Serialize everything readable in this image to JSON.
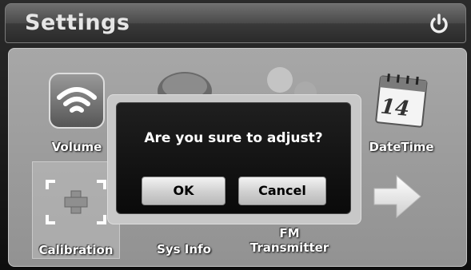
{
  "header": {
    "title": "Settings",
    "power_icon": "power-icon"
  },
  "tiles": [
    {
      "label": "Volume",
      "icon": "wifi-volume-icon"
    },
    {
      "label": "",
      "icon": "bubble-icon"
    },
    {
      "label": "",
      "icon": "users-icon"
    },
    {
      "label": "DateTime",
      "icon": "calendar-icon",
      "calendar_day": "14"
    },
    {
      "label": "Calibration",
      "icon": "crosshair-icon",
      "selected": true
    },
    {
      "label": "Sys Info",
      "icon": "info-icon"
    },
    {
      "label": "FM\nTransmitter",
      "label_line1": "FM",
      "label_line2": "Transmitter",
      "icon": "radio-icon"
    },
    {
      "label": "",
      "icon": "arrow-right-icon"
    }
  ],
  "dialog": {
    "message": "Are you sure to adjust?",
    "ok_label": "OK",
    "cancel_label": "Cancel"
  },
  "colors": {
    "panel": "#9e9e9e",
    "dialog_bg": "#111111",
    "title_text": "#e6e6e6"
  }
}
